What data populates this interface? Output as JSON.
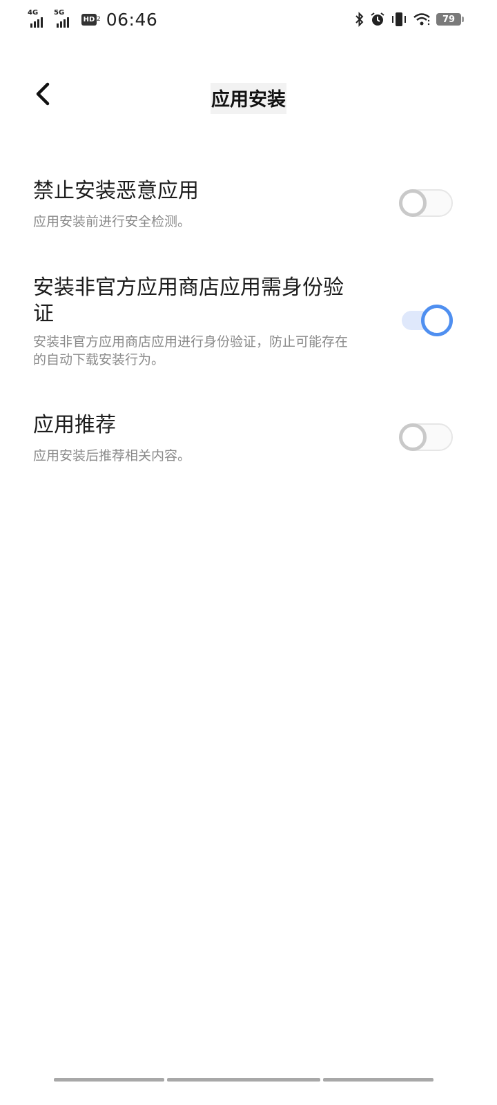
{
  "status_bar": {
    "signal1_label": "4G",
    "signal2_label": "5G",
    "hd_label": "HD",
    "hd_sub": "2",
    "time": "06:46",
    "battery_level": "79",
    "icons": [
      "bluetooth-icon",
      "alarm-icon",
      "vibrate-icon",
      "wifi-icon",
      "battery-icon"
    ]
  },
  "header": {
    "title": "应用安装",
    "back_icon": "chevron-left-icon"
  },
  "settings": [
    {
      "title": "禁止安装恶意应用",
      "description": "应用安装前进行安全检测。",
      "enabled": false
    },
    {
      "title": "安装非官方应用商店应用需身份验证",
      "description": "安装非官方应用商店应用进行身份验证，防止可能存在的自动下载安装行为。",
      "enabled": true
    },
    {
      "title": "应用推荐",
      "description": "应用安装后推荐相关内容。",
      "enabled": false
    }
  ],
  "colors": {
    "accent": "#4f8ff0",
    "accent_track": "#dfe8fb",
    "switch_off_knob": "#c9c9c9",
    "description_text": "#8a8a8a"
  }
}
